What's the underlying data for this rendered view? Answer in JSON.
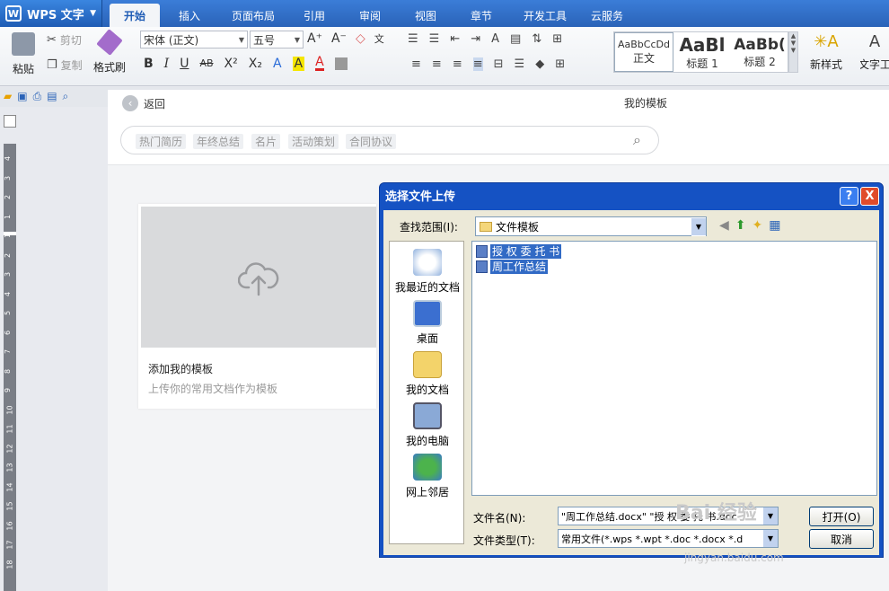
{
  "app": {
    "name": "WPS 文字",
    "logo": "W"
  },
  "tabs": [
    "开始",
    "插入",
    "页面布局",
    "引用",
    "审阅",
    "视图",
    "章节",
    "开发工具",
    "云服务"
  ],
  "ribbon": {
    "paste": "粘贴",
    "cut": "剪切",
    "copy": "复制",
    "format_painter": "格式刷",
    "font_name": "宋体 (正文)",
    "font_size": "五号",
    "styles": [
      {
        "sample": "AaBbCcDd",
        "name": "正文"
      },
      {
        "sample": "AaBl",
        "name": "标题 1"
      },
      {
        "sample": "AaBb(",
        "name": "标题 2"
      }
    ],
    "new_style": "新样式",
    "text_tools": "文字工",
    "format_buttons": [
      "B",
      "I",
      "U",
      "AB",
      "X²",
      "X₂",
      "A",
      "A",
      "A"
    ]
  },
  "panel": {
    "back": "返回",
    "title": "我的模板",
    "search_tags": [
      "热门简历",
      "年终总结",
      "名片",
      "活动策划",
      "合同协议"
    ],
    "card_title": "添加我的模板",
    "card_desc": "上传你的常用文档作为模板"
  },
  "ruler_numbers": [
    "4",
    "3",
    "2",
    "1",
    "1",
    "2",
    "3",
    "4",
    "5",
    "6",
    "7",
    "8",
    "9",
    "10",
    "11",
    "12",
    "13",
    "14",
    "15",
    "16",
    "17",
    "18"
  ],
  "dialog": {
    "title": "选择文件上传",
    "help": "?",
    "close": "X",
    "lookin_label": "查找范围(I):",
    "lookin_value": "文件模板",
    "places": [
      "我最近的文档",
      "桌面",
      "我的文档",
      "我的电脑",
      "网上邻居"
    ],
    "files": [
      "授 权 委 托 书",
      "周工作总结"
    ],
    "filename_label": "文件名(N):",
    "filename_value": "\"周工作总结.docx\" \"授 权 委 托 书.doc",
    "filetype_label": "文件类型(T):",
    "filetype_value": "常用文件(*.wps *.wpt *.doc *.docx *.d",
    "open_button": "打开(O)",
    "cancel_button": "取消"
  },
  "watermark": {
    "brand": "Bai 经验",
    "url": "jingyan.baidu.com"
  },
  "colors": {
    "accent": "#2a63b8",
    "dialog_title": "#1552c3",
    "selection": "#316ac5"
  }
}
